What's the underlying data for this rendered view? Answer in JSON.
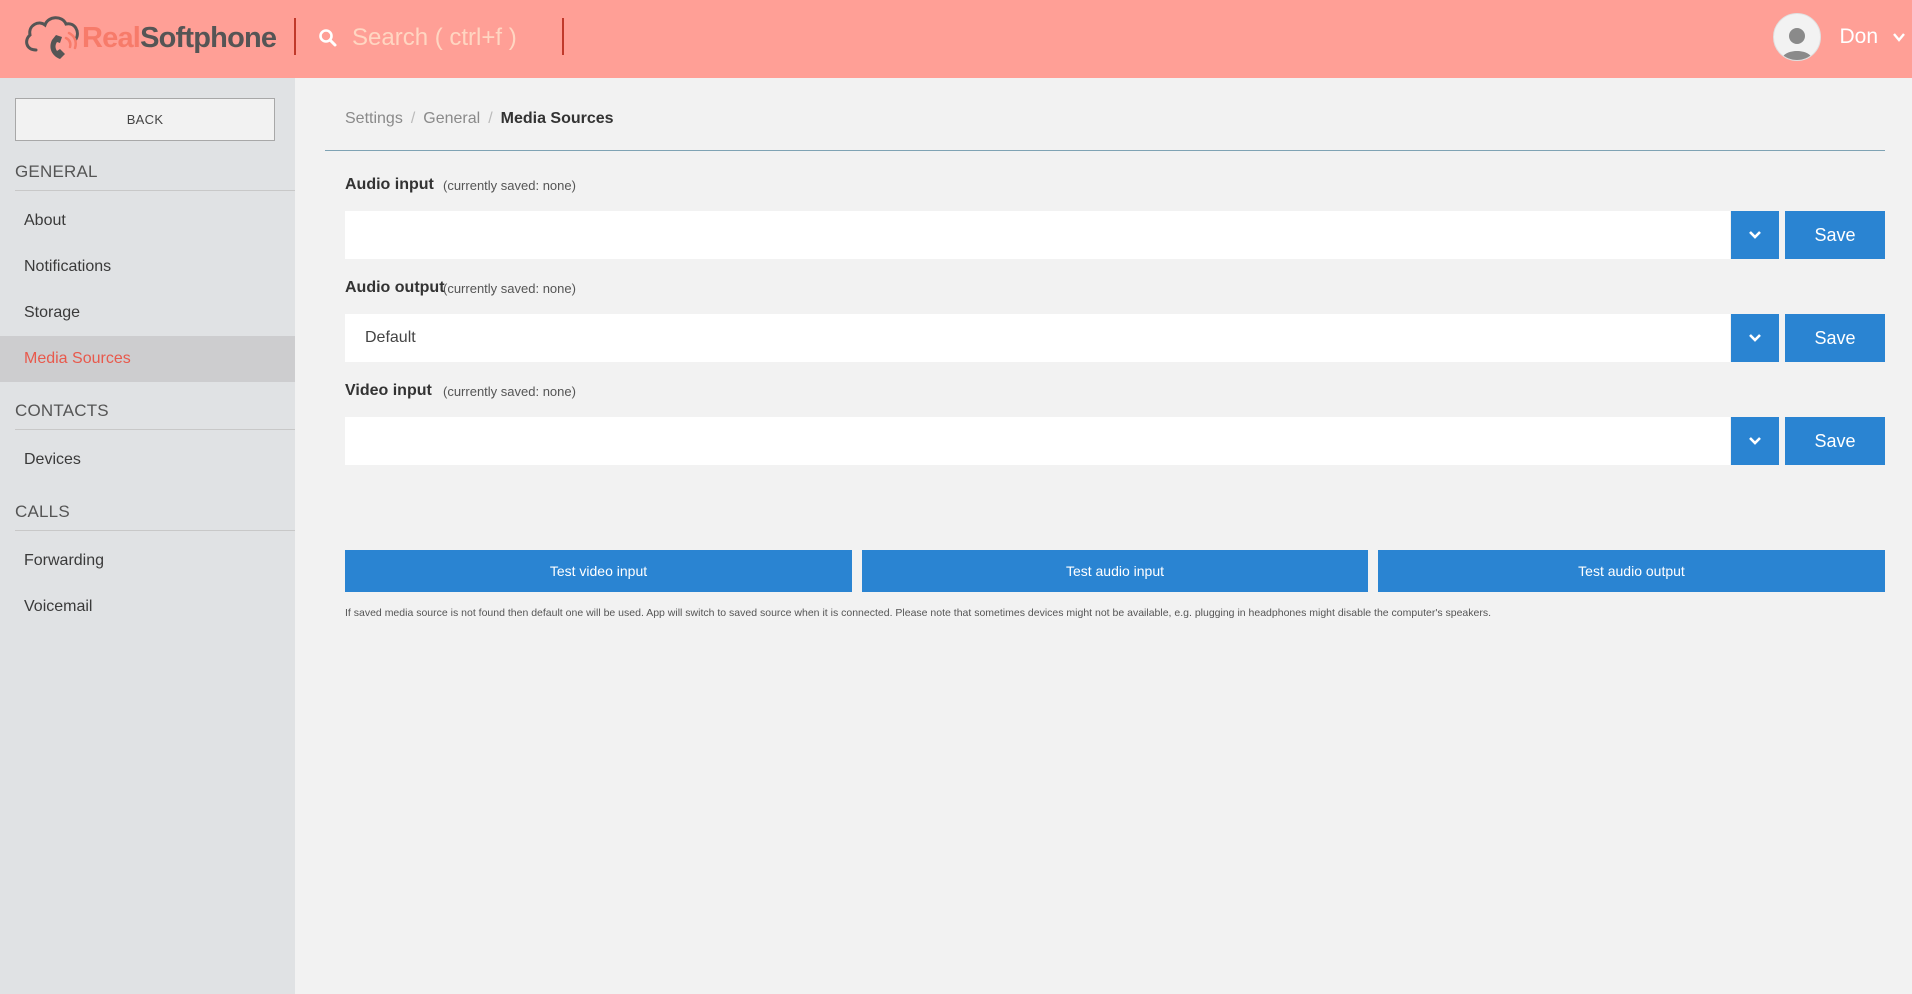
{
  "header": {
    "logo": {
      "part1": "Real",
      "part2": "Softphone"
    },
    "search_placeholder": "Search ( ctrl+f )",
    "user_name": "Don",
    "colors": {
      "bar": "#ff9f96",
      "divider": "#c0392b"
    }
  },
  "sidebar": {
    "back_label": "BACK",
    "sections": [
      {
        "title": "GENERAL",
        "items": [
          "About",
          "Notifications",
          "Storage",
          "Media Sources"
        ]
      },
      {
        "title": "CONTACTS",
        "items": [
          "Devices"
        ]
      },
      {
        "title": "CALLS",
        "items": [
          "Forwarding",
          "Voicemail"
        ]
      }
    ],
    "active_item": "Media Sources"
  },
  "breadcrumb": [
    "Settings",
    "General",
    "Media Sources"
  ],
  "media": {
    "audio_input": {
      "label": "Audio input",
      "note": "(currently saved: none)",
      "value": "",
      "save_label": "Save"
    },
    "audio_output": {
      "label": "Audio output",
      "note": "(currently saved: none)",
      "value": "Default",
      "save_label": "Save"
    },
    "video_input": {
      "label": "Video input",
      "note": "(currently saved: none)",
      "value": "",
      "save_label": "Save"
    }
  },
  "tests": [
    "Test video input",
    "Test audio input",
    "Test audio output"
  ],
  "footnote": "If saved media source is not found then default one will be used. App will switch to saved source when it is connected. Please note that sometimes devices might not be available, e.g. plugging in headphones might disable the computer's speakers.",
  "colors": {
    "accent": "#2a84d2",
    "active_item": "#e8594c"
  }
}
